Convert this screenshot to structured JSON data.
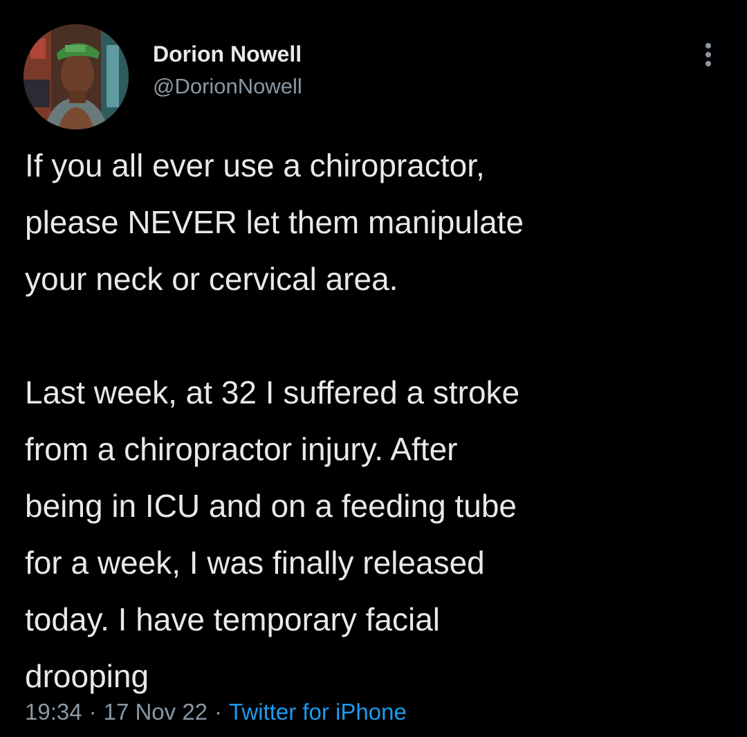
{
  "author": {
    "display_name": "Dorion Nowell",
    "handle": "@DorionNowell"
  },
  "tweet": {
    "paragraphs": [
      "If you all ever use a chiropractor,\nplease NEVER let them manipulate\nyour neck or cervical area.",
      "Last week, at 32 I suffered a stroke\nfrom a chiropractor injury. After\nbeing in ICU and on a feeding tube\nfor a week, I was finally released\ntoday. I have temporary facial\ndrooping"
    ]
  },
  "meta": {
    "time": "19:34",
    "date": "17 Nov 22",
    "separator": "·",
    "source": "Twitter for iPhone"
  },
  "icons": {
    "more": "more-vertical-icon"
  },
  "colors": {
    "background": "#000000",
    "primary_text": "#e7e9ea",
    "secondary_text": "#8b98a5",
    "link": "#1d9bf0"
  }
}
